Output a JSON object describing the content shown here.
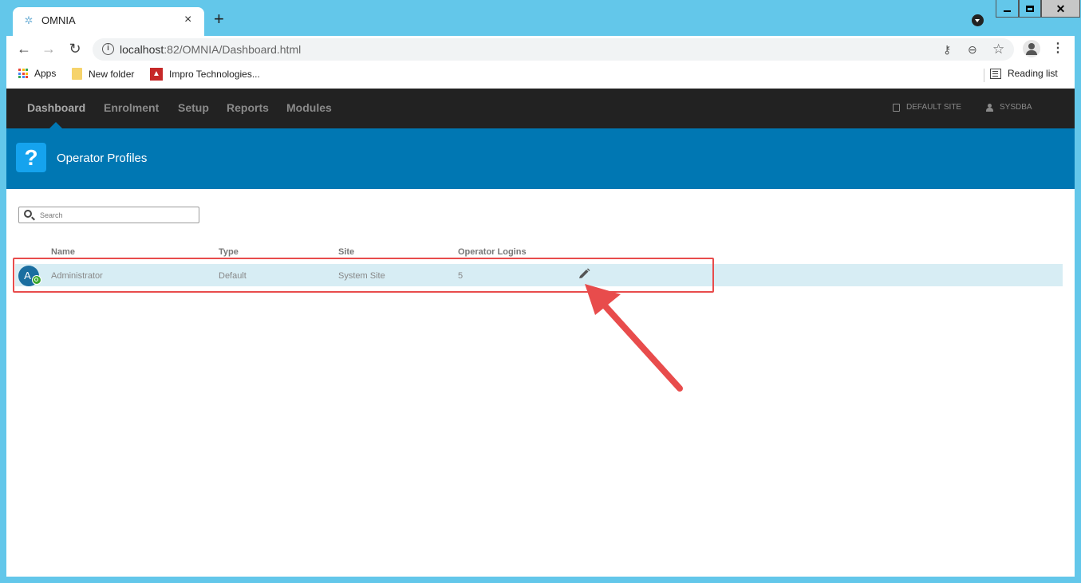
{
  "browser": {
    "tab_title": "OMNIA",
    "tab_close": "×",
    "new_tab": "+",
    "url_host": "localhost",
    "url_rest": ":82/OMNIA/Dashboard.html",
    "window_close": "✕"
  },
  "bookmarks": {
    "apps": "Apps",
    "new_folder": "New folder",
    "impro": "Impro Technologies...",
    "reading_list": "Reading list"
  },
  "topnav": {
    "items": [
      "Dashboard",
      "Enrolment",
      "Setup",
      "Reports",
      "Modules"
    ],
    "site": "DEFAULT SITE",
    "user": "SYSDBA"
  },
  "banner": {
    "icon_glyph": "?",
    "title": "Operator Profiles"
  },
  "search": {
    "placeholder": "Search"
  },
  "table": {
    "columns": [
      "Name",
      "Type",
      "Site",
      "Operator Logins"
    ],
    "rows": [
      {
        "avatar_letter": "A",
        "name": "Administrator",
        "type": "Default",
        "site": "System Site",
        "logins": "5"
      }
    ]
  },
  "annotation": {
    "color": "#e84c4c"
  },
  "colors": {
    "browser_frame": "#63c7ea",
    "nav_bg": "#222222",
    "banner_bg": "#0077b3",
    "row_highlight": "#d7edf4"
  }
}
